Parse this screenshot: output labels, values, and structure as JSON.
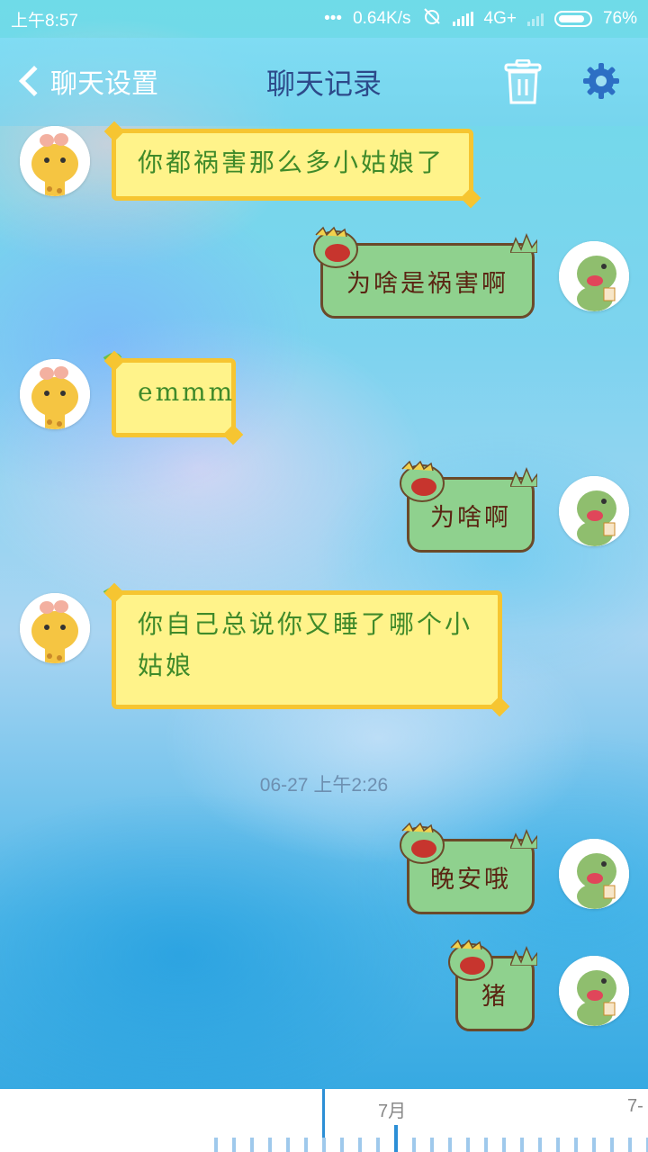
{
  "status_bar": {
    "time": "上午8:57",
    "dots": "•••",
    "speed": "0.64K/s",
    "network": "4G+",
    "battery": "76%"
  },
  "nav": {
    "back_label": "聊天设置",
    "title": "聊天记录"
  },
  "messages": [
    {
      "side": "left",
      "text": "你都祸害那么多小姑娘了"
    },
    {
      "side": "right",
      "text": "为啥是祸害啊"
    },
    {
      "side": "left",
      "text": "emmm"
    },
    {
      "side": "right",
      "text": "为啥啊"
    },
    {
      "side": "left",
      "text": "你自己总说你又睡了哪个小姑娘"
    },
    {
      "side": "right",
      "text": "晚安哦"
    },
    {
      "side": "right",
      "text": "猪"
    }
  ],
  "timestamp": "06-27 上午2:26",
  "timeline": {
    "month_label": "7月",
    "next_label": "7-"
  },
  "colors": {
    "left_bubble": "#fff38a",
    "left_border": "#f6c531",
    "left_text": "#3f8a2a",
    "right_bubble": "#8fd18e",
    "right_text": "#5a2412",
    "accent": "#2c8fd6"
  }
}
